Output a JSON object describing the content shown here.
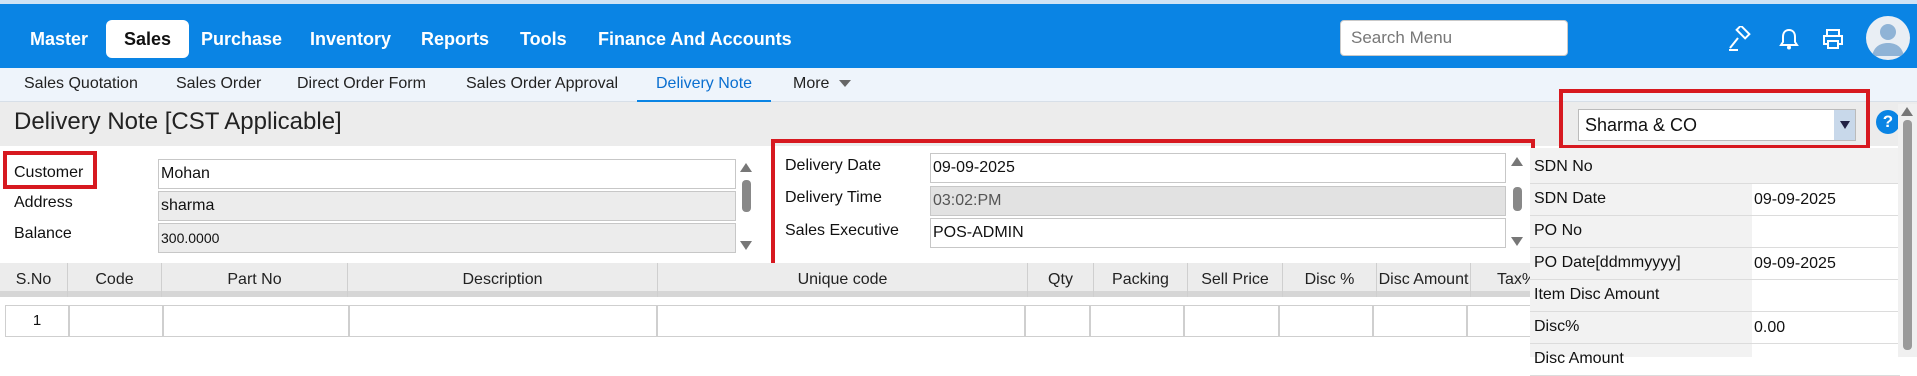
{
  "nav": {
    "menu": [
      "Master",
      "Sales",
      "Purchase",
      "Inventory",
      "Reports",
      "Tools",
      "Finance And Accounts"
    ],
    "active": "Sales",
    "search_placeholder": "Search Menu",
    "icons": [
      "hammer-icon",
      "bell-icon",
      "printer-icon",
      "user-avatar-icon"
    ]
  },
  "subnav": {
    "tabs": [
      "Sales Quotation",
      "Sales Order",
      "Direct Order Form",
      "Sales Order Approval",
      "Delivery Note",
      "More"
    ],
    "active": "Delivery Note"
  },
  "page": {
    "title": "Delivery Note [CST Applicable]"
  },
  "company": {
    "selected": "Sharma & CO"
  },
  "customer": {
    "customer_label": "Customer",
    "customer_value": "Mohan",
    "address_label": "Address",
    "address_value": "sharma",
    "balance_label": "Balance",
    "balance_value": "300.0000"
  },
  "delivery": {
    "date_label": "Delivery Date",
    "date_value": "09-09-2025",
    "time_label": "Delivery Time",
    "time_value": "03:02:PM",
    "exec_label": "Sales Executive",
    "exec_value": "POS-ADMIN"
  },
  "grid": {
    "columns": [
      "S.No",
      "Code",
      "Part No",
      "Description",
      "Unique code",
      "Qty",
      "Packing",
      "Sell Price",
      "Disc %",
      "Disc Amount",
      "Tax%"
    ],
    "rows": [
      [
        "1",
        "",
        "",
        "",
        "",
        "",
        "",
        "",
        "",
        "",
        ""
      ]
    ]
  },
  "summary": [
    {
      "label": "SDN No",
      "value": ""
    },
    {
      "label": "SDN Date",
      "value": "09-09-2025"
    },
    {
      "label": "PO No",
      "value": ""
    },
    {
      "label": "PO Date[ddmmyyyy]",
      "value": "09-09-2025"
    },
    {
      "label": "Item Disc Amount",
      "value": ""
    },
    {
      "label": "Disc%",
      "value": "0.00"
    },
    {
      "label": "Disc Amount",
      "value": ""
    }
  ],
  "colors": {
    "primary": "#0a84e4",
    "highlight": "#d71920"
  }
}
